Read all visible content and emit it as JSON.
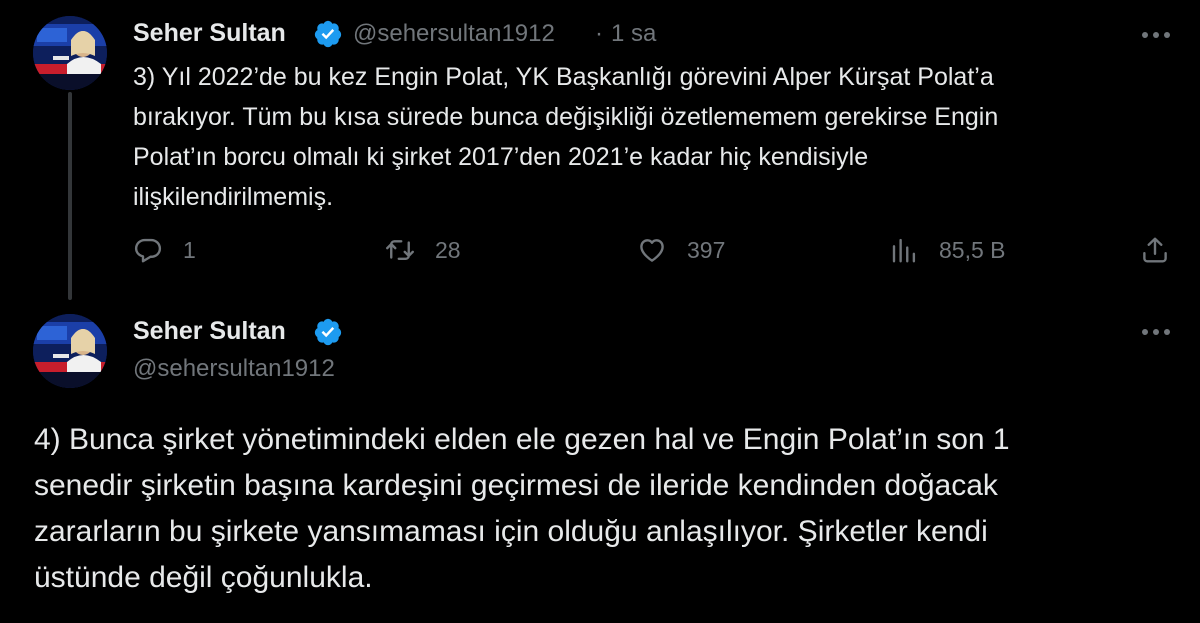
{
  "tweet1": {
    "author_name": "Seher Sultan",
    "author_handle": "@sehersultan1912",
    "separator": "·",
    "time": "1 sa",
    "text_lines": [
      "3) Yıl 2022’de bu kez Engin Polat, YK Başkanlığı görevini Alper Kürşat Polat’a",
      "bırakıyor. Tüm bu kısa sürede bunca değişikliği özetlememem gerekirse Engin",
      "Polat’ın borcu olmalı ki şirket 2017’den 2021’e kadar hiç kendisiyle",
      "ilişkilendirilmemiş."
    ],
    "actions": {
      "replies": "1",
      "reposts": "28",
      "likes": "397",
      "views": "85,5 B"
    }
  },
  "tweet2": {
    "author_name": "Seher Sultan",
    "author_handle": "@sehersultan1912",
    "text_lines": [
      "4) Bunca şirket yönetimindeki elden ele gezen hal ve Engin Polat’ın son 1",
      "senedir şirketin başına kardeşini geçirmesi de ileride kendinden doğacak",
      "zararların bu şirkete yansımaması için olduğu anlaşılıyor. Şirketler kendi",
      "üstünde değil çoğunlukla."
    ]
  },
  "icons": {
    "verified": "verified-badge-icon",
    "more": "more-dots-icon",
    "reply": "reply-bubble-icon",
    "repost": "repost-arrows-icon",
    "like": "heart-icon",
    "views": "bar-chart-icon",
    "share": "share-upload-icon"
  },
  "colors": {
    "background": "#000000",
    "text": "#e7e9ea",
    "secondary": "#71767b",
    "verified": "#1d9bf0",
    "thread_line": "#333639"
  }
}
